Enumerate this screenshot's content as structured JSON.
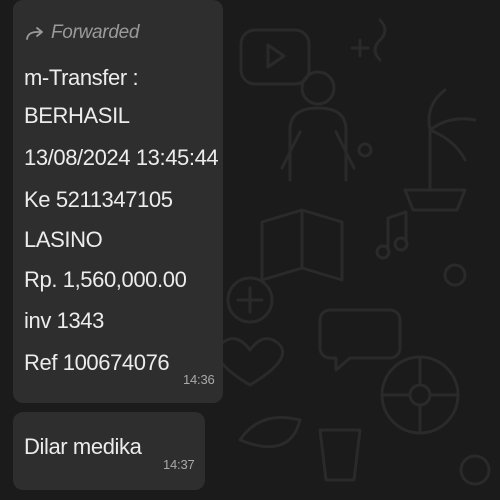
{
  "chat": {
    "messages": [
      {
        "forwarded_label": "Forwarded",
        "lines": [
          "m-Transfer :",
          "BERHASIL",
          "13/08/2024 13:45:44",
          "Ke 5211347105",
          "LASINO",
          "Rp. 1,560,000.00",
          "inv 1343",
          "Ref 100674076"
        ],
        "time": "14:36"
      },
      {
        "text": "Dilar medika",
        "time": "14:37"
      }
    ]
  },
  "icons": {
    "forward": "forward-arrow-icon"
  },
  "colors": {
    "background": "#1b1b1b",
    "bubble": "#2e2e2e",
    "text": "#ececec",
    "meta": "#a8a8a8"
  }
}
